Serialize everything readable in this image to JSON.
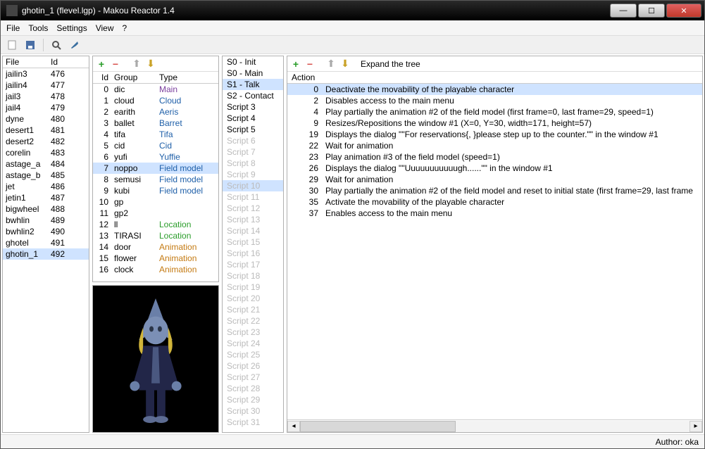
{
  "window": {
    "title": "ghotin_1 (flevel.lgp) - Makou Reactor 1.4"
  },
  "menus": [
    "File",
    "Tools",
    "Settings",
    "View",
    "?"
  ],
  "toolbar_icons": [
    "new-icon",
    "save-icon",
    "search-icon",
    "wrench-icon"
  ],
  "file_table": {
    "headers": [
      "File",
      "Id"
    ],
    "rows": [
      {
        "name": "jailin3",
        "id": "476"
      },
      {
        "name": "jailin4",
        "id": "477"
      },
      {
        "name": "jail3",
        "id": "478"
      },
      {
        "name": "jail4",
        "id": "479"
      },
      {
        "name": "dyne",
        "id": "480"
      },
      {
        "name": "desert1",
        "id": "481"
      },
      {
        "name": "desert2",
        "id": "482"
      },
      {
        "name": "corelin",
        "id": "483"
      },
      {
        "name": "astage_a",
        "id": "484"
      },
      {
        "name": "astage_b",
        "id": "485"
      },
      {
        "name": "jet",
        "id": "486"
      },
      {
        "name": "jetin1",
        "id": "487"
      },
      {
        "name": "bigwheel",
        "id": "488"
      },
      {
        "name": "bwhlin",
        "id": "489"
      },
      {
        "name": "bwhlin2",
        "id": "490"
      },
      {
        "name": "ghotel",
        "id": "491"
      },
      {
        "name": "ghotin_1",
        "id": "492",
        "selected": true
      }
    ]
  },
  "group_table": {
    "headers": [
      "Id",
      "Group",
      "Type"
    ],
    "rows": [
      {
        "id": "0",
        "group": "dic",
        "type": "Main",
        "color": "t-purple"
      },
      {
        "id": "1",
        "group": "cloud",
        "type": "Cloud",
        "color": "t-blue"
      },
      {
        "id": "2",
        "group": "earith",
        "type": "Aeris",
        "color": "t-blue"
      },
      {
        "id": "3",
        "group": "ballet",
        "type": "Barret",
        "color": "t-blue"
      },
      {
        "id": "4",
        "group": "tifa",
        "type": "Tifa",
        "color": "t-blue"
      },
      {
        "id": "5",
        "group": "cid",
        "type": "Cid",
        "color": "t-blue"
      },
      {
        "id": "6",
        "group": "yufi",
        "type": "Yuffie",
        "color": "t-blue"
      },
      {
        "id": "7",
        "group": "noppo",
        "type": "Field model",
        "color": "t-blue",
        "selected": true
      },
      {
        "id": "8",
        "group": "semusi",
        "type": "Field model",
        "color": "t-blue"
      },
      {
        "id": "9",
        "group": "kubi",
        "type": "Field model",
        "color": "t-blue"
      },
      {
        "id": "10",
        "group": "gp",
        "type": "",
        "color": ""
      },
      {
        "id": "11",
        "group": "gp2",
        "type": "",
        "color": ""
      },
      {
        "id": "12",
        "group": "ll",
        "type": "Location",
        "color": "t-green"
      },
      {
        "id": "13",
        "group": "TIRASI",
        "type": "Location",
        "color": "t-green"
      },
      {
        "id": "14",
        "group": "door",
        "type": "Animation",
        "color": "t-orange"
      },
      {
        "id": "15",
        "group": "flower",
        "type": "Animation",
        "color": "t-orange"
      },
      {
        "id": "16",
        "group": "clock",
        "type": "Animation",
        "color": "t-orange"
      }
    ]
  },
  "script_list": {
    "items": [
      {
        "label": "S0 - Init"
      },
      {
        "label": "S0 - Main"
      },
      {
        "label": "S1 - Talk",
        "selected": true
      },
      {
        "label": "S2 - Contact"
      },
      {
        "label": "Script 3"
      },
      {
        "label": "Script 4"
      },
      {
        "label": "Script 5"
      },
      {
        "label": "Script 6",
        "disabled": true
      },
      {
        "label": "Script 7",
        "disabled": true
      },
      {
        "label": "Script 8",
        "disabled": true
      },
      {
        "label": "Script 9",
        "disabled": true
      },
      {
        "label": "Script 10",
        "disabled": true,
        "selected2": true
      },
      {
        "label": "Script 11",
        "disabled": true
      },
      {
        "label": "Script 12",
        "disabled": true
      },
      {
        "label": "Script 13",
        "disabled": true
      },
      {
        "label": "Script 14",
        "disabled": true
      },
      {
        "label": "Script 15",
        "disabled": true
      },
      {
        "label": "Script 16",
        "disabled": true
      },
      {
        "label": "Script 17",
        "disabled": true
      },
      {
        "label": "Script 18",
        "disabled": true
      },
      {
        "label": "Script 19",
        "disabled": true
      },
      {
        "label": "Script 20",
        "disabled": true
      },
      {
        "label": "Script 21",
        "disabled": true
      },
      {
        "label": "Script 22",
        "disabled": true
      },
      {
        "label": "Script 23",
        "disabled": true
      },
      {
        "label": "Script 24",
        "disabled": true
      },
      {
        "label": "Script 25",
        "disabled": true
      },
      {
        "label": "Script 26",
        "disabled": true
      },
      {
        "label": "Script 27",
        "disabled": true
      },
      {
        "label": "Script 28",
        "disabled": true
      },
      {
        "label": "Script 29",
        "disabled": true
      },
      {
        "label": "Script 30",
        "disabled": true
      },
      {
        "label": "Script 31",
        "disabled": true
      }
    ]
  },
  "action_pane": {
    "expand_label": "Expand the tree",
    "header": "Action",
    "rows": [
      {
        "n": "0",
        "text": "Deactivate the movability of the playable character",
        "selected": true
      },
      {
        "n": "2",
        "text": "Disables access to the main menu"
      },
      {
        "n": "4",
        "text": "Play partially the animation #2 of the field model (first frame=0, last frame=29, speed=1)"
      },
      {
        "n": "9",
        "text": "Resizes/Repositions the window #1 (X=0, Y=30, width=171, height=57)"
      },
      {
        "n": "19",
        "text": "Displays the dialog \"\"For reservations{, }please step up to the counter.\"\" in the window #1"
      },
      {
        "n": "22",
        "text": "Wait for animation"
      },
      {
        "n": "23",
        "text": "Play animation #3 of the field model (speed=1)"
      },
      {
        "n": "26",
        "text": "Displays the dialog \"\"Uuuuuuuuuuugh......\"\" in the window #1"
      },
      {
        "n": "29",
        "text": "Wait for animation"
      },
      {
        "n": "30",
        "text": "Play partially the animation #2 of the field model and reset to initial state (first frame=29, last frame"
      },
      {
        "n": "35",
        "text": "Activate the movability of the playable character"
      },
      {
        "n": "37",
        "text": "Enables access to the main menu"
      }
    ]
  },
  "statusbar": {
    "author": "Author: oka"
  }
}
